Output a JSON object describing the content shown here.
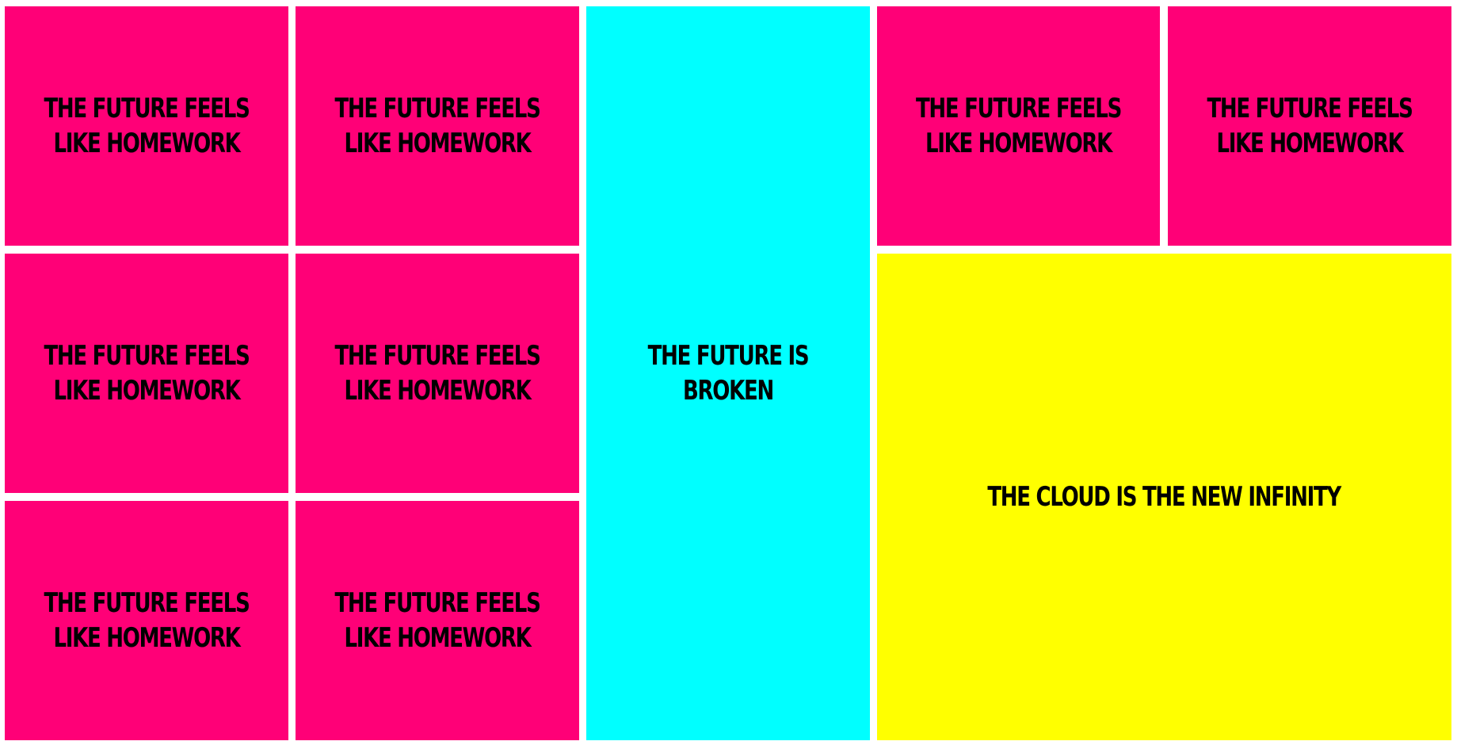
{
  "tiles": [
    {
      "id": "pink-1",
      "text": "THE FUTURE FEELS LIKE HOMEWORK",
      "color": "#ff0077"
    },
    {
      "id": "pink-2",
      "text": "THE FUTURE FEELS LIKE HOMEWORK",
      "color": "#ff0077"
    },
    {
      "id": "cyan-1",
      "text": "THE FUTURE IS BROKEN",
      "color": "#00ffff"
    },
    {
      "id": "pink-3",
      "text": "THE FUTURE FEELS LIKE HOMEWORK",
      "color": "#ff0077"
    },
    {
      "id": "pink-4",
      "text": "THE FUTURE FEELS LIKE HOMEWORK",
      "color": "#ff0077"
    },
    {
      "id": "pink-5",
      "text": "THE FUTURE FEELS LIKE HOMEWORK",
      "color": "#ff0077"
    },
    {
      "id": "pink-6",
      "text": "THE FUTURE FEELS LIKE HOMEWORK",
      "color": "#ff0077"
    },
    {
      "id": "pink-7",
      "text": "THE FUTURE FEELS LIKE HOMEWORK",
      "color": "#ff0077"
    },
    {
      "id": "pink-8",
      "text": "THE FUTURE FEELS LIKE HOMEWORK",
      "color": "#ff0077"
    },
    {
      "id": "yellow-1",
      "text": "THE CLOUD IS THE NEW INFINITY",
      "color": "#ffff00"
    }
  ]
}
